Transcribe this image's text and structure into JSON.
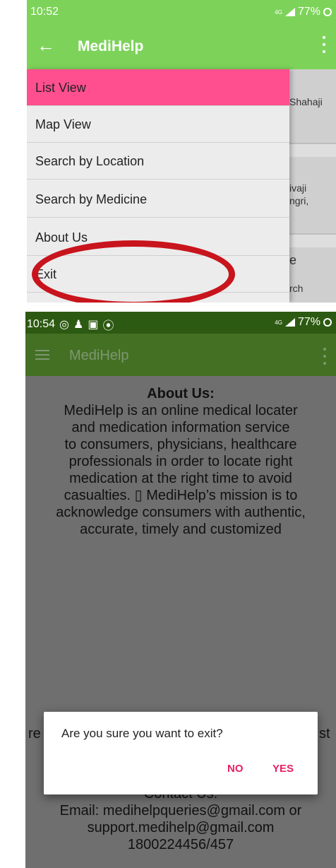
{
  "screen1": {
    "status": {
      "time": "10:52",
      "network": "4G",
      "battery": "77%"
    },
    "appbar": {
      "title": "MediHelp"
    },
    "menu": [
      {
        "label": "List View"
      },
      {
        "label": "Map View"
      },
      {
        "label": "Search by Location"
      },
      {
        "label": "Search by Medicine"
      },
      {
        "label": "About Us"
      },
      {
        "label": "Exit"
      }
    ],
    "background_cards": [
      "Shahaji",
      "ivaji",
      "ngri,",
      "e",
      "rch"
    ],
    "active_color": "#ff4f8e",
    "highlight_color": "#c8141c"
  },
  "screen2": {
    "status": {
      "time": "10:54",
      "network": "4G",
      "battery": "77%"
    },
    "appbar": {
      "title": "MediHelp"
    },
    "about": {
      "heading": "About Us:",
      "lines": [
        "MediHelp is an online medical locater",
        "and medication information service",
        "to consumers, physicians, healthcare",
        "professionals in order to locate right",
        "medication at the right time to avoid",
        "casualties. ▯ MediHelp’s mission is to",
        "acknowledge consumers with authentic,",
        "accurate, timely and customized",
        "",
        "re",
        "t"
      ],
      "right_fragment": "st"
    },
    "contact": {
      "heading": "Contact Us:",
      "line1": "Email: medihelpqueries@gmail.com or",
      "line2": "support.medihelp@gmail.com",
      "line3": "1800224456/457"
    },
    "dialog": {
      "message": "Are you sure you want to exit?",
      "no_label": "NO",
      "yes_label": "YES"
    },
    "accent_color": "#e91e63"
  }
}
